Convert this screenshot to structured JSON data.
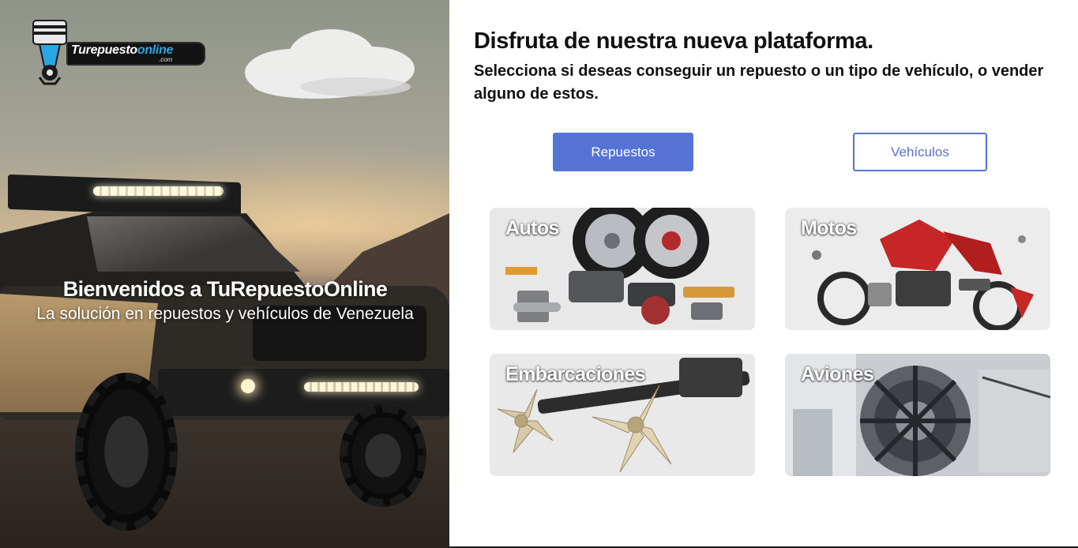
{
  "brand": {
    "logo_text_main": "Turepuesto",
    "logo_text_accent": "online",
    "logo_text_sub": ".com"
  },
  "hero": {
    "title": "Bienvenidos a TuRepuestoOnline",
    "subtitle": "La solución en repuestos y vehículos de Venezuela"
  },
  "main": {
    "heading": "Disfruta de nuestra nueva plataforma.",
    "subheading": "Selecciona si deseas conseguir un repuesto o un tipo de vehículo, o vender alguno de estos."
  },
  "toggle": {
    "repuestos_label": "Repuestos",
    "vehiculos_label": "Vehículos",
    "selected": "Repuestos"
  },
  "categories": [
    {
      "label": "Autos"
    },
    {
      "label": "Motos"
    },
    {
      "label": "Embarcaciones"
    },
    {
      "label": "Aviones"
    }
  ],
  "colors": {
    "accent": "#5572d6",
    "text": "#111111",
    "card_bg": "#e6e6e6"
  }
}
